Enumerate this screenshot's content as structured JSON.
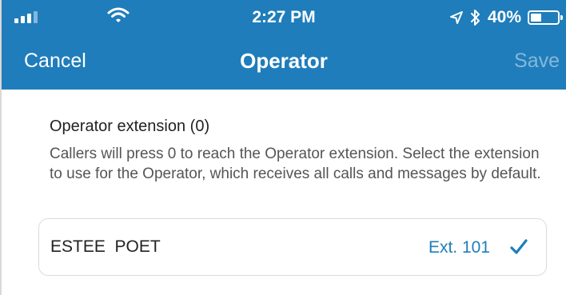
{
  "status_bar": {
    "time": "2:27 PM",
    "battery_percent_label": "40%",
    "battery_level": 0.4,
    "icons": [
      "cellular-signal-icon",
      "wifi-icon",
      "location-arrow-icon",
      "bluetooth-icon",
      "battery-icon"
    ]
  },
  "nav": {
    "cancel_label": "Cancel",
    "title": "Operator",
    "save_label": "Save"
  },
  "content": {
    "section_label": "Operator extension (0)",
    "description": "Callers will press 0 to reach the Operator extension. Select the extension to use for the Operator, which receives all calls and messages by default.",
    "selected_operator": {
      "name": "ESTEE  POET",
      "extension": "Ext. 101",
      "selected": true
    }
  },
  "colors": {
    "header_background": "#1f7dbb",
    "accent": "#1f7dbb",
    "text_primary": "#222222",
    "text_secondary": "#555555"
  }
}
